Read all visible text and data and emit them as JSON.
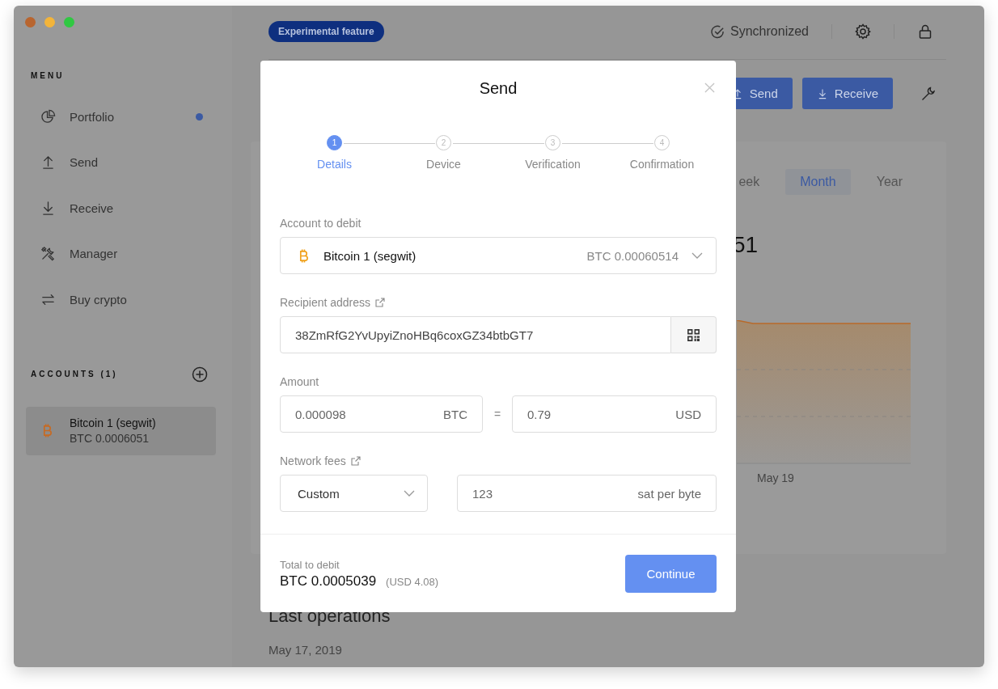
{
  "sidebar": {
    "menu_title": "MENU",
    "items": [
      {
        "label": "Portfolio",
        "notification": true
      },
      {
        "label": "Send",
        "notification": false
      },
      {
        "label": "Receive",
        "notification": false
      },
      {
        "label": "Manager",
        "notification": false
      },
      {
        "label": "Buy crypto",
        "notification": false
      }
    ],
    "accounts_title": "ACCOUNTS (1)",
    "accounts": [
      {
        "name": "Bitcoin 1 (segwit)",
        "balance": "BTC 0.0006051",
        "selected": true
      }
    ]
  },
  "topbar": {
    "badge": "Experimental feature",
    "sync_status": "Synchronized"
  },
  "actions": [
    {
      "label": "Send"
    },
    {
      "label": "Receive"
    }
  ],
  "chart_card": {
    "ranges": [
      {
        "label": "eek",
        "selected": false
      },
      {
        "label": "Month",
        "selected": true
      },
      {
        "label": "Year",
        "selected": false
      }
    ],
    "balance": "51",
    "x_label": "May 19"
  },
  "operations": {
    "title": "Last operations",
    "date": "May 17, 2019"
  },
  "modal": {
    "title": "Send",
    "steps": [
      {
        "number": "1",
        "label": "Details",
        "selected": true
      },
      {
        "number": "2",
        "label": "Device",
        "selected": false
      },
      {
        "number": "3",
        "label": "Verification",
        "selected": false
      },
      {
        "number": "4",
        "label": "Confirmation",
        "selected": false
      }
    ],
    "account_label": "Account to debit",
    "account": {
      "name": "Bitcoin 1 (segwit)",
      "balance": "BTC 0.00060514"
    },
    "recipient_label": "Recipient address",
    "recipient": "38ZmRfG2YvUpyiZnoHBq6coxGZ34btbGT7",
    "amount_label": "Amount",
    "amount": {
      "crypto_value": "0.000098",
      "crypto_unit": "BTC",
      "equals": "=",
      "fiat_value": "0.79",
      "fiat_unit": "USD"
    },
    "fees_label": "Network fees",
    "fee_mode": "Custom",
    "fee_value": "123",
    "fee_unit": "sat per byte",
    "total_label": "Total to debit",
    "total": "BTC 0.0005039",
    "total_fiat": "(USD 4.08)",
    "continue": "Continue"
  }
}
